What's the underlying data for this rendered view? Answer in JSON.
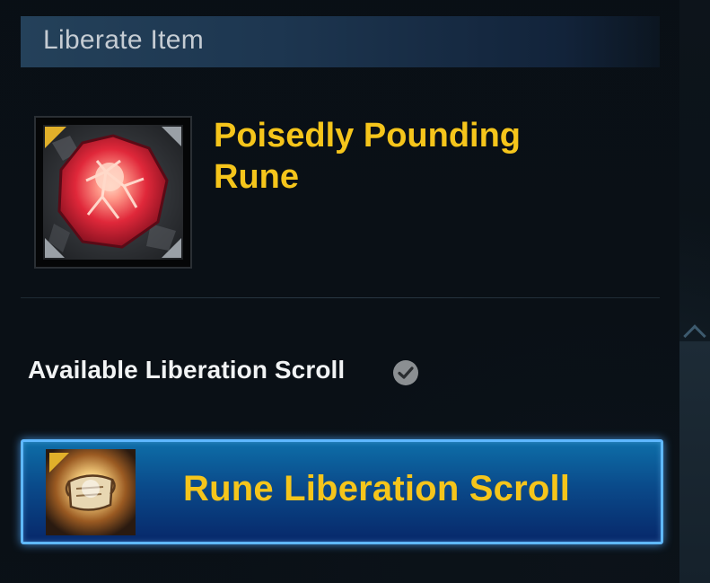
{
  "header": {
    "title": "Liberate Item"
  },
  "item": {
    "name": "Poisedly Pounding Rune",
    "icon": "red-rune-gem-icon",
    "rarity_color": "#e1b02a"
  },
  "liberation": {
    "label": "Available Liberation Scroll",
    "info_icon": "check-circle-icon"
  },
  "scroll_button": {
    "label": "Rune Liberation Scroll",
    "icon": "scroll-icon"
  },
  "colors": {
    "gold_text": "#f5c51b",
    "button_glow": "#5fb8ff"
  }
}
